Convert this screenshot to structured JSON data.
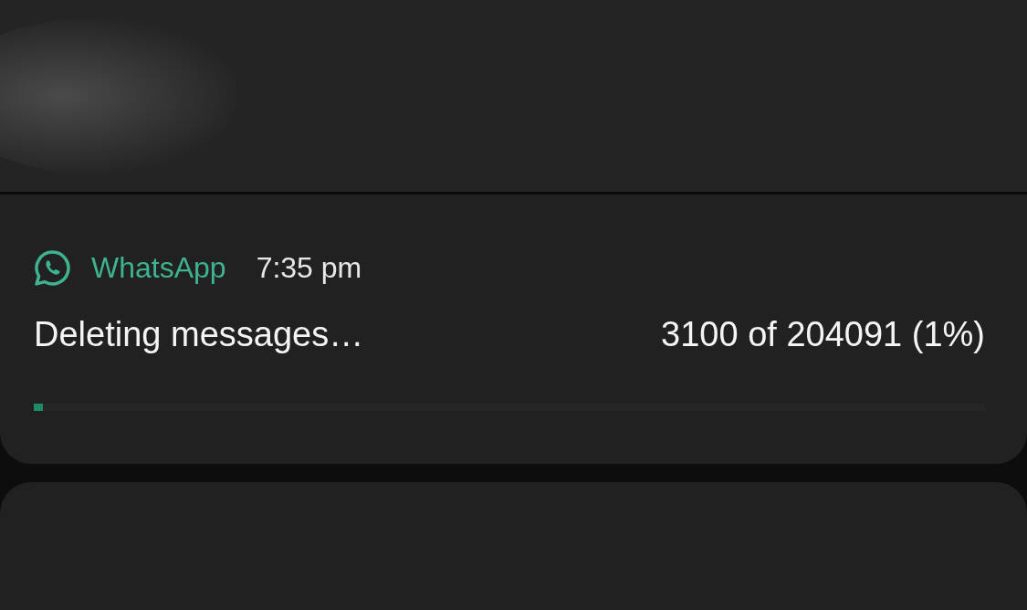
{
  "notification": {
    "app_name": "WhatsApp",
    "time": "7:35 pm",
    "title": "Deleting messages…",
    "progress_text": "3100 of 204091 (1%)",
    "progress": {
      "level": 0.01
    }
  }
}
